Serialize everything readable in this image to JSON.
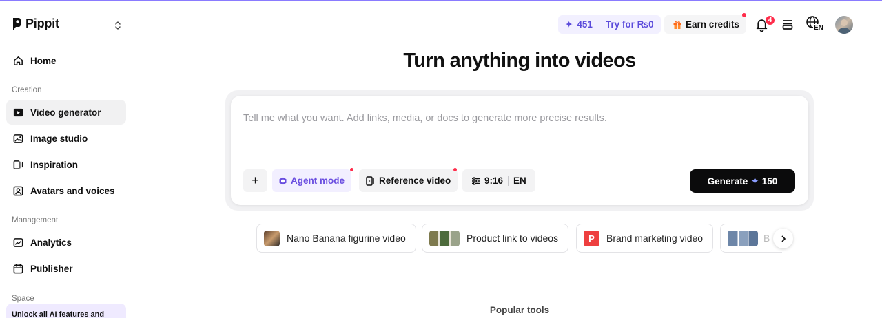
{
  "brand": {
    "name": "Pippit"
  },
  "sidebar": {
    "home": "Home",
    "sections": {
      "creation": "Creation",
      "management": "Management",
      "space": "Space"
    },
    "creation_items": [
      {
        "label": "Video generator",
        "icon": "video-play-icon",
        "active": true
      },
      {
        "label": "Image studio",
        "icon": "image-icon"
      },
      {
        "label": "Inspiration",
        "icon": "inspiration-icon"
      },
      {
        "label": "Avatars and voices",
        "icon": "avatar-icon"
      }
    ],
    "management_items": [
      {
        "label": "Analytics",
        "icon": "analytics-icon"
      },
      {
        "label": "Publisher",
        "icon": "calendar-icon"
      }
    ],
    "unlock_text": "Unlock all AI features and"
  },
  "topbar": {
    "credits": "451",
    "try_label": "Try for ₨0",
    "earn_label": "Earn credits",
    "notification_count": "4",
    "language": "EN"
  },
  "main": {
    "title": "Turn anything into videos",
    "prompt_placeholder": "Tell me what you want. Add links, media, or docs to generate more precise results.",
    "add_label": "+",
    "agent_label": "Agent mode",
    "reference_label": "Reference video",
    "ratio": "9:16",
    "lang": "EN",
    "generate_label": "Generate",
    "generate_cost": "150",
    "suggestions": [
      "Nano Banana figurine video",
      "Product link to videos",
      "Brand marketing video",
      "B"
    ],
    "brand_tile_letter": "P",
    "popular_tools": "Popular tools"
  },
  "colors": {
    "accent": "#6a4ee0",
    "badge": "#ff2d4b",
    "dark": "#0b0b0c"
  }
}
